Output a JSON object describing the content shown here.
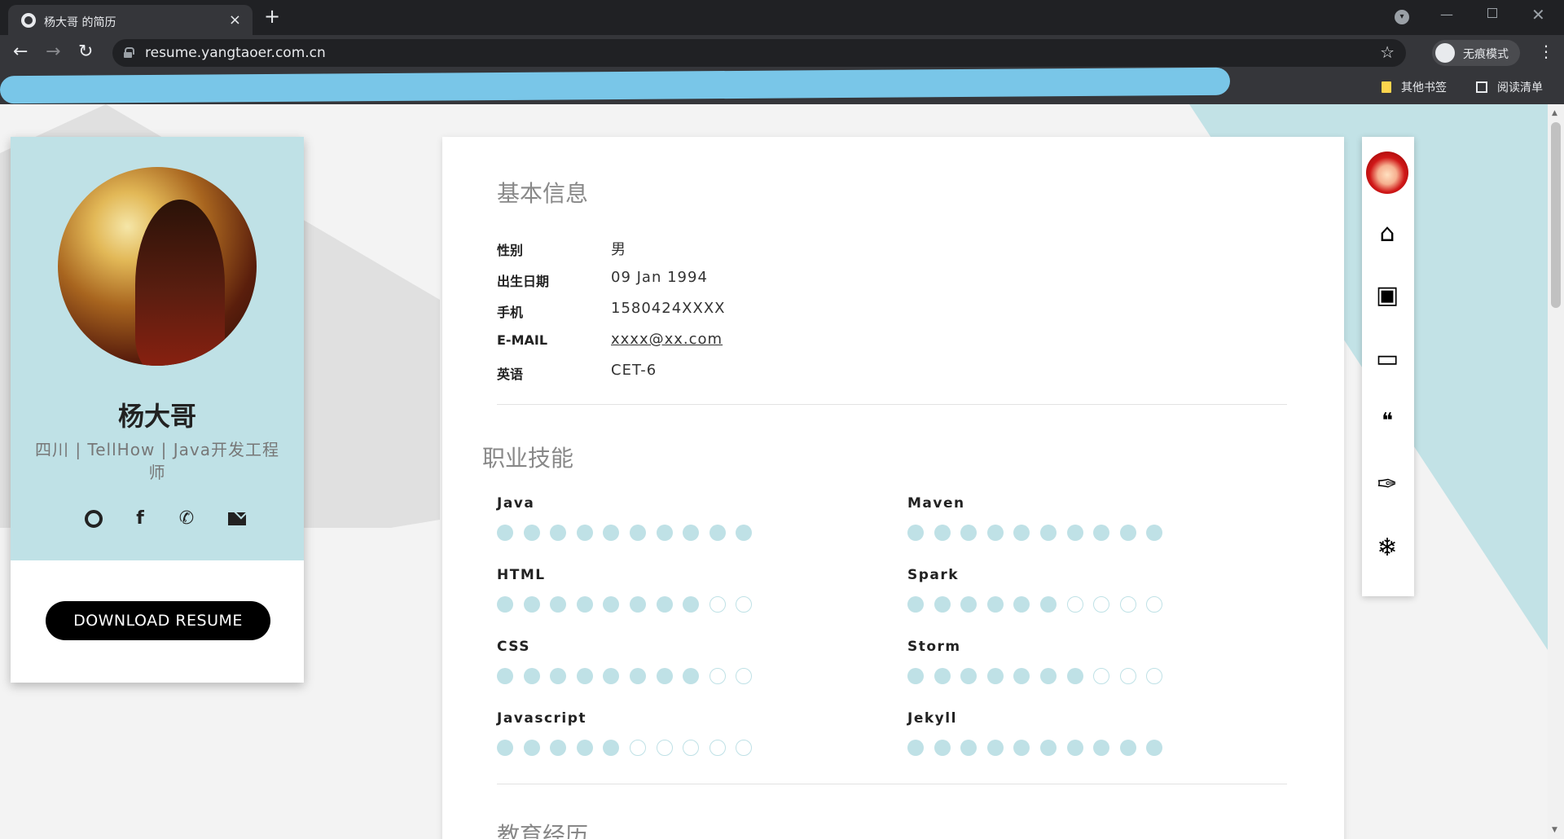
{
  "browser": {
    "tab_title": "杨大哥 的简历",
    "url": "resume.yangtaoer.com.cn",
    "incognito_label": "无痕模式",
    "bookmarks": {
      "other": "其他书签",
      "reading_list": "阅读清单"
    }
  },
  "profile": {
    "name": "杨大哥",
    "subtitle": "四川 | TellHow | Java开发工程师",
    "download_label": "DOWNLOAD RESUME"
  },
  "basic_info": {
    "title": "基本信息",
    "rows": [
      {
        "label": "性别",
        "value": "男"
      },
      {
        "label": "出生日期",
        "value": "09 Jan 1994"
      },
      {
        "label": "手机",
        "value": "1580424XXXX"
      },
      {
        "label": "E-MAIL",
        "value": "xxxx@xx.com"
      },
      {
        "label": "英语",
        "value": "CET-6"
      }
    ]
  },
  "skills": {
    "title": "职业技能",
    "max": 10,
    "items": [
      {
        "name": "Java",
        "level": 10
      },
      {
        "name": "Maven",
        "level": 10
      },
      {
        "name": "HTML",
        "level": 8
      },
      {
        "name": "Spark",
        "level": 6
      },
      {
        "name": "CSS",
        "level": 8
      },
      {
        "name": "Storm",
        "level": 7
      },
      {
        "name": "Javascript",
        "level": 5
      },
      {
        "name": "Jekyll",
        "level": 10
      }
    ]
  },
  "education": {
    "title": "教育经历"
  },
  "icons": {
    "home": "home-icon",
    "briefcase": "briefcase-icon",
    "image": "image-icon",
    "quote": "quote-icon",
    "feather": "feather-icon",
    "snowflake": "snowflake-icon"
  },
  "colors": {
    "accent": "#bfe1e6",
    "chrome_dark": "#202124"
  }
}
